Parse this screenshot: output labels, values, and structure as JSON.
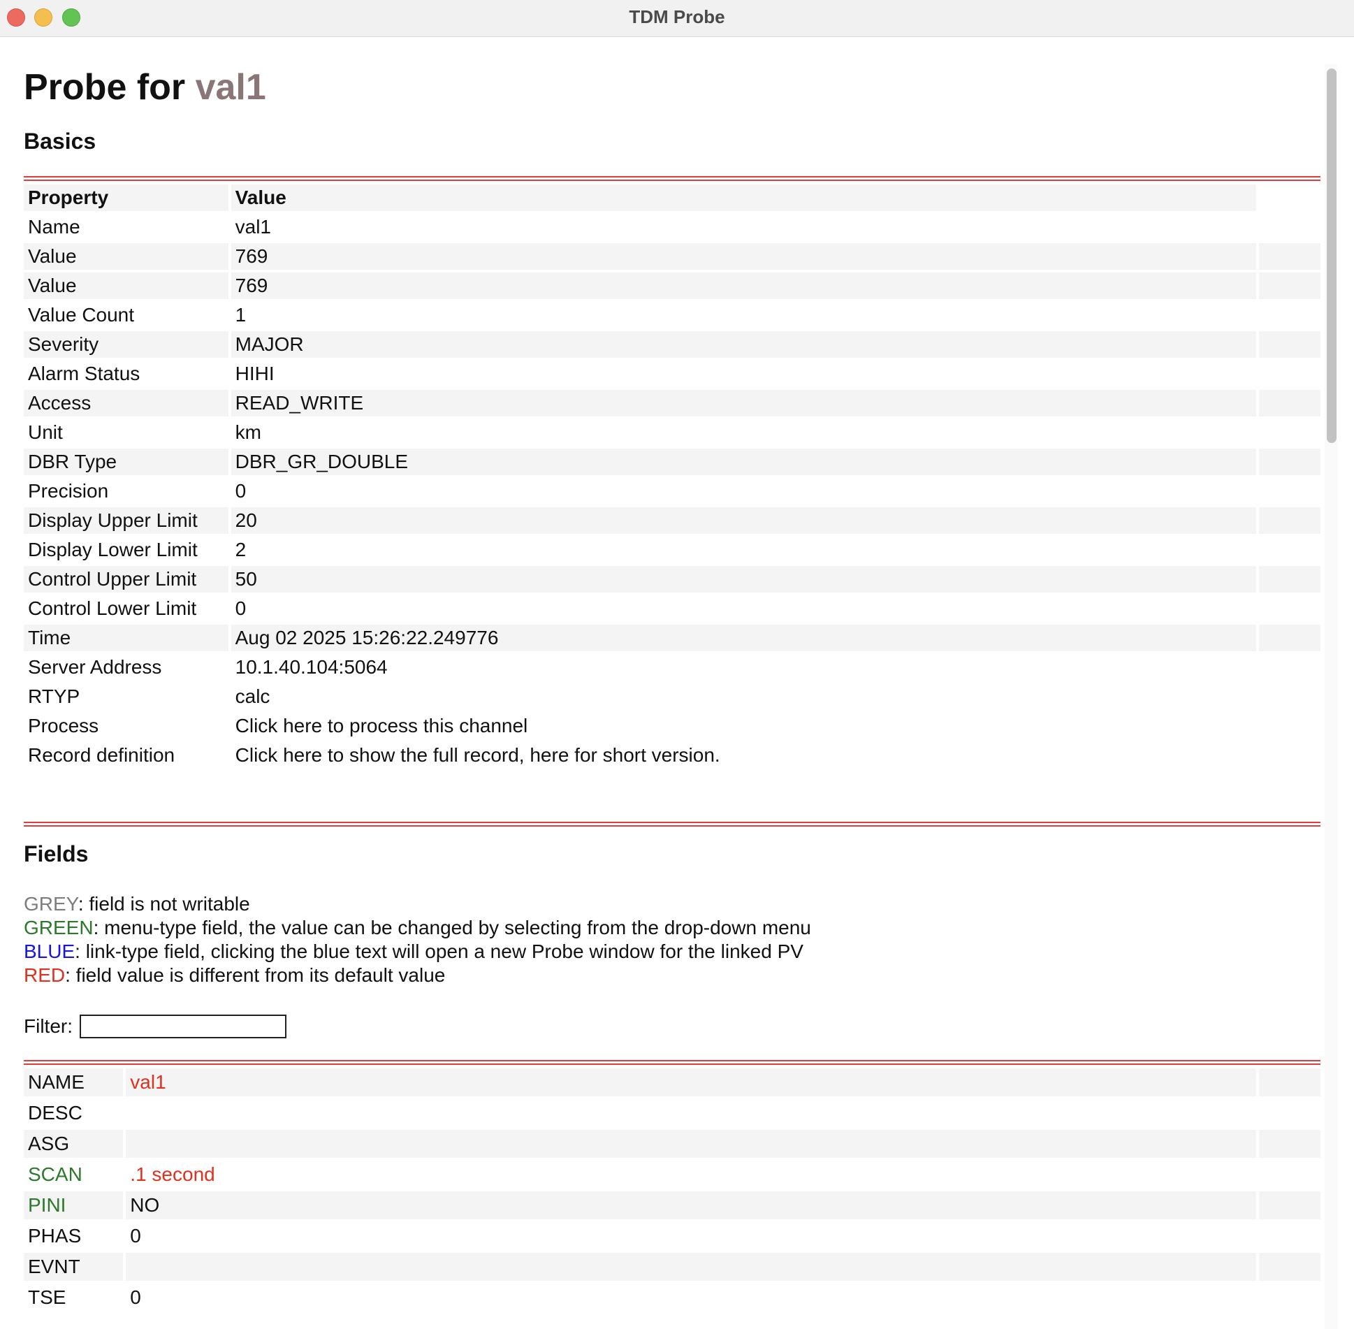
{
  "window": {
    "title": "TDM Probe"
  },
  "page": {
    "title_prefix": "Probe for",
    "pv_name": "val1"
  },
  "basics": {
    "heading": "Basics",
    "header": {
      "property": "Property",
      "value": "Value"
    },
    "rows": [
      {
        "property": "Name",
        "value": "val1"
      },
      {
        "property": "Value",
        "value": "769"
      },
      {
        "property": "Value",
        "value": "769"
      },
      {
        "property": "Value Count",
        "value": "1"
      },
      {
        "property": "Severity",
        "value": "MAJOR"
      },
      {
        "property": "Alarm Status",
        "value": "HIHI"
      },
      {
        "property": "Access",
        "value": "READ_WRITE"
      },
      {
        "property": "Unit",
        "value": "km"
      },
      {
        "property": "DBR Type",
        "value": "DBR_GR_DOUBLE"
      },
      {
        "property": "Precision",
        "value": "0"
      },
      {
        "property": "Display Upper Limit",
        "value": "20"
      },
      {
        "property": "Display Lower Limit",
        "value": "2"
      },
      {
        "property": "Control Upper Limit",
        "value": "50"
      },
      {
        "property": "Control Lower Limit",
        "value": "0"
      },
      {
        "property": "Time",
        "value": "Aug 02 2025 15:26:22.249776"
      },
      {
        "property": "Server Address",
        "value": "10.1.40.104:5064"
      },
      {
        "property": "RTYP",
        "value": "calc"
      },
      {
        "property": "Process",
        "value": "Click here to process this channel"
      },
      {
        "property": "Record definition",
        "value": "Click here to show the full record, here for short version."
      }
    ]
  },
  "fields": {
    "heading": "Fields",
    "legend": [
      {
        "key": "GREY",
        "text": ": field is not writable"
      },
      {
        "key": "GREEN",
        "text": ": menu-type field, the value can be changed by selecting from the drop-down menu"
      },
      {
        "key": "BLUE",
        "text": ": link-type field, clicking the blue text will open a new Probe window for the linked PV"
      },
      {
        "key": "RED",
        "text": ": field value is different from its default value"
      }
    ],
    "filter_label": "Filter:",
    "filter_value": "",
    "rows": [
      {
        "name": "NAME",
        "value": "val1"
      },
      {
        "name": "DESC",
        "value": ""
      },
      {
        "name": "ASG",
        "value": ""
      },
      {
        "name": "SCAN",
        "value": ".1 second"
      },
      {
        "name": "PINI",
        "value": "NO"
      },
      {
        "name": "PHAS",
        "value": "0"
      },
      {
        "name": "EVNT",
        "value": ""
      },
      {
        "name": "TSE",
        "value": "0"
      }
    ]
  },
  "colors": {
    "grey": "#7d7d7d",
    "green": "#2b7a2b",
    "blue": "#1515e8",
    "red": "#e0301e",
    "rule": "#e23b3b",
    "row_shade": "#f4f4f4",
    "pv_name": "#8a7676"
  }
}
